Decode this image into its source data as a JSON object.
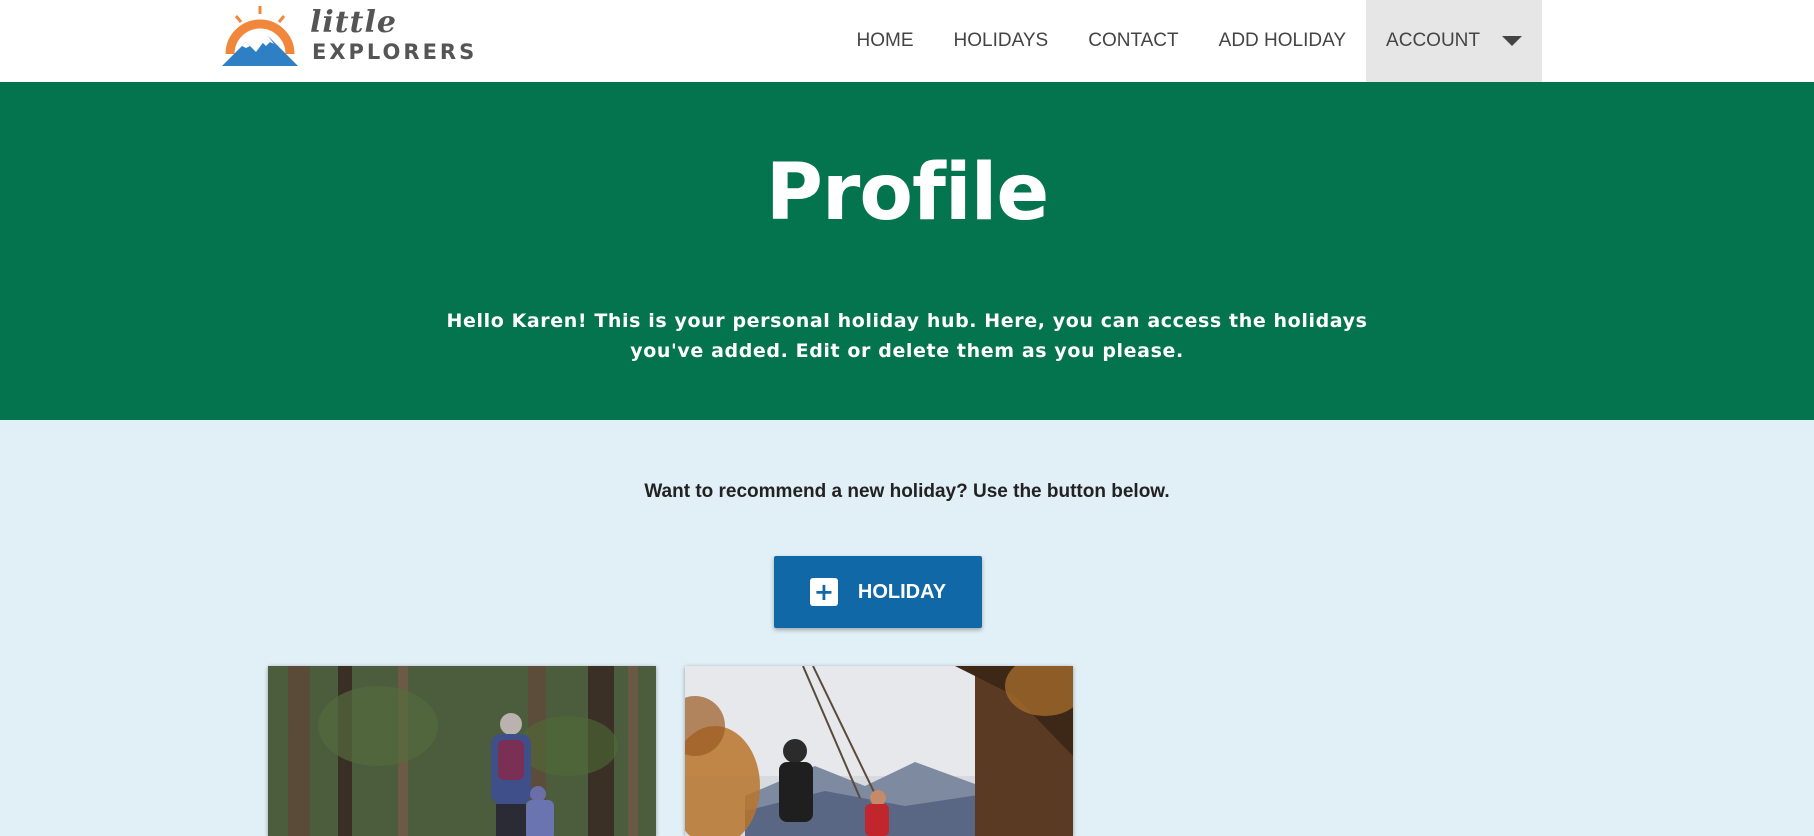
{
  "brand": {
    "logo_small": "little",
    "logo_big": "EXPLORERS"
  },
  "nav": {
    "items": [
      {
        "label": "HOME"
      },
      {
        "label": "HOLIDAYS"
      },
      {
        "label": "CONTACT"
      },
      {
        "label": "ADD HOLIDAY"
      },
      {
        "label": "ACCOUNT"
      }
    ]
  },
  "hero": {
    "title": "Profile",
    "text": "Hello Karen! This is your personal holiday hub. Here, you can access the holidays you've added. Edit or delete them as you please."
  },
  "main": {
    "prompt": "Want to recommend a new holiday? Use the button below.",
    "add_button_label": "HOLIDAY"
  },
  "colors": {
    "hero_bg": "#04744e",
    "page_bg": "#e1eff6",
    "button_bg": "#1168a7"
  },
  "icons": {
    "add": "plus-icon",
    "account_dropdown": "caret-down-icon"
  }
}
